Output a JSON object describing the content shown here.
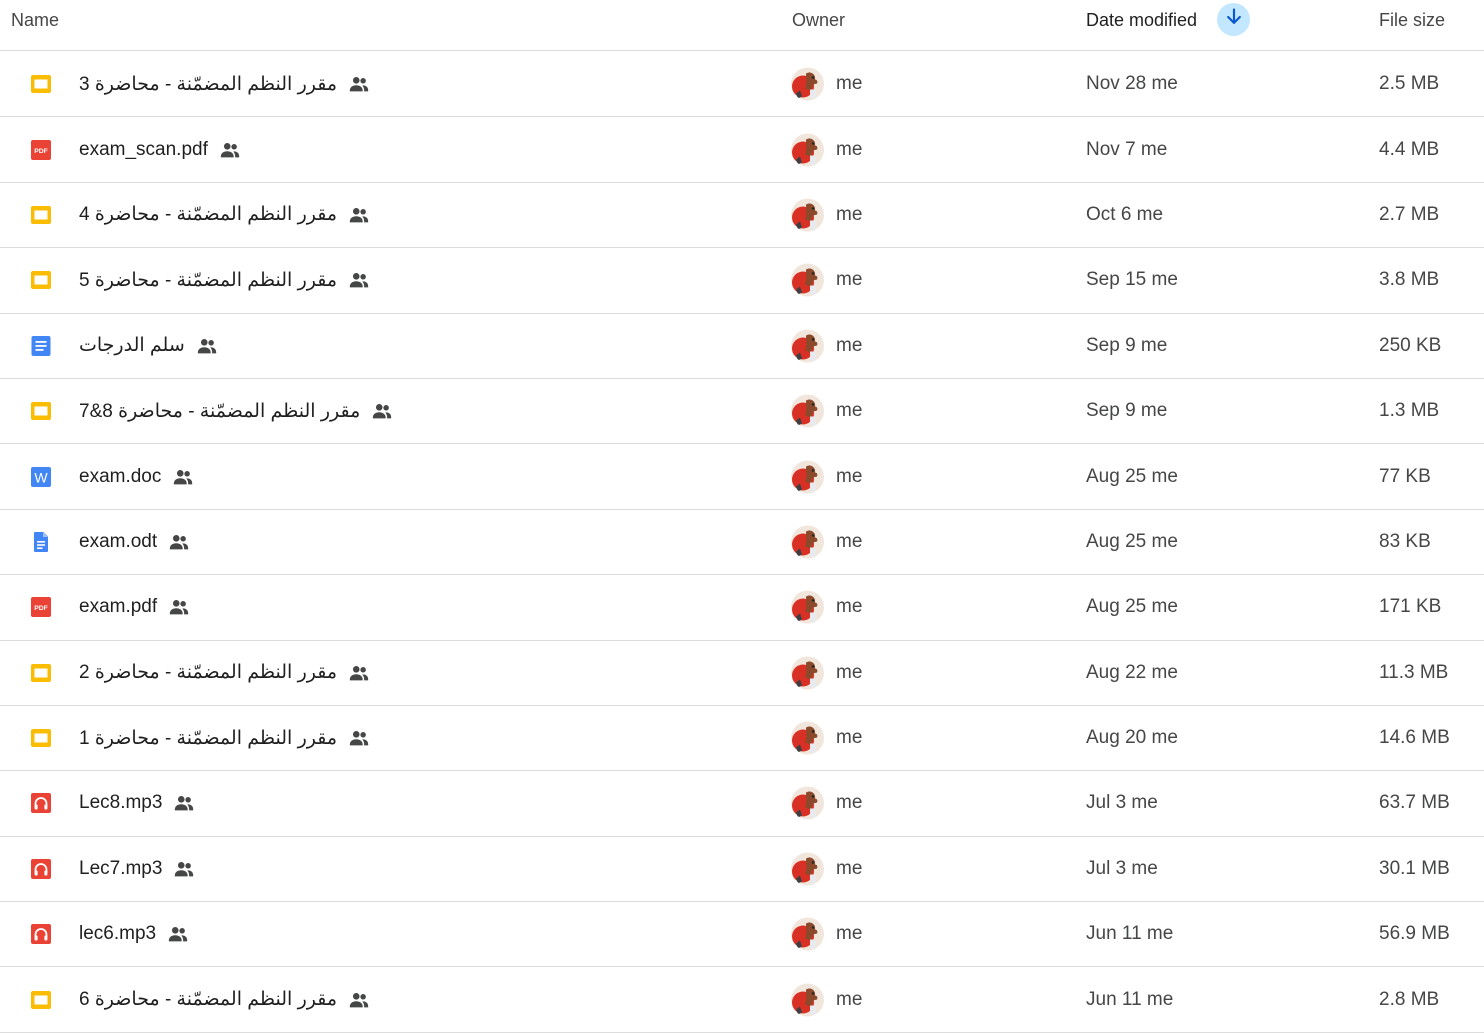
{
  "header": {
    "name_label": "Name",
    "owner_label": "Owner",
    "date_label": "Date modified",
    "size_label": "File size",
    "sort_icon": "arrow-down-icon",
    "sort_color": "#c2e7ff"
  },
  "icon_colors": {
    "slides": "#fbbc04",
    "pdf": "#ea4335",
    "docs": "#4285f4",
    "word": "#4285f4",
    "audio": "#ea4335"
  },
  "files": [
    {
      "type": "slides",
      "icon": "slides-icon",
      "name": "مقرر النظم المضمّنة - محاضرة 3",
      "owner": "me",
      "modified": "Nov 28 me",
      "size": "2.5 MB"
    },
    {
      "type": "pdf",
      "icon": "pdf-icon",
      "name": "exam_scan.pdf",
      "owner": "me",
      "modified": "Nov 7 me",
      "size": "4.4 MB"
    },
    {
      "type": "slides",
      "icon": "slides-icon",
      "name": "مقرر النظم المضمّنة - محاضرة 4",
      "owner": "me",
      "modified": "Oct 6 me",
      "size": "2.7 MB"
    },
    {
      "type": "slides",
      "icon": "slides-icon",
      "name": "مقرر النظم المضمّنة - محاضرة 5",
      "owner": "me",
      "modified": "Sep 15 me",
      "size": "3.8 MB"
    },
    {
      "type": "docs",
      "icon": "docs-icon",
      "name": "سلم الدرجات",
      "owner": "me",
      "modified": "Sep 9 me",
      "size": "250 KB"
    },
    {
      "type": "slides",
      "icon": "slides-icon",
      "name": "مقرر النظم المضمّنة - محاضرة 8&7",
      "owner": "me",
      "modified": "Sep 9 me",
      "size": "1.3 MB"
    },
    {
      "type": "word",
      "icon": "word-icon",
      "name": "exam.doc",
      "owner": "me",
      "modified": "Aug 25 me",
      "size": "77 KB"
    },
    {
      "type": "docfile",
      "icon": "document-icon",
      "name": "exam.odt",
      "owner": "me",
      "modified": "Aug 25 me",
      "size": "83 KB"
    },
    {
      "type": "pdf",
      "icon": "pdf-icon",
      "name": "exam.pdf",
      "owner": "me",
      "modified": "Aug 25 me",
      "size": "171 KB"
    },
    {
      "type": "slides",
      "icon": "slides-icon",
      "name": "مقرر النظم المضمّنة - محاضرة 2",
      "owner": "me",
      "modified": "Aug 22 me",
      "size": "11.3 MB"
    },
    {
      "type": "slides",
      "icon": "slides-icon",
      "name": "مقرر النظم المضمّنة - محاضرة 1",
      "owner": "me",
      "modified": "Aug 20 me",
      "size": "14.6 MB"
    },
    {
      "type": "audio",
      "icon": "headphones-icon",
      "name": "Lec8.mp3",
      "owner": "me",
      "modified": "Jul 3 me",
      "size": "63.7 MB"
    },
    {
      "type": "audio",
      "icon": "headphones-icon",
      "name": "Lec7.mp3",
      "owner": "me",
      "modified": "Jul 3 me",
      "size": "30.1 MB"
    },
    {
      "type": "audio",
      "icon": "headphones-icon",
      "name": "lec6.mp3",
      "owner": "me",
      "modified": "Jun 11 me",
      "size": "56.9 MB"
    },
    {
      "type": "slides",
      "icon": "slides-icon",
      "name": "مقرر النظم المضمّنة - محاضرة 6",
      "owner": "me",
      "modified": "Jun 11 me",
      "size": "2.8 MB"
    }
  ]
}
